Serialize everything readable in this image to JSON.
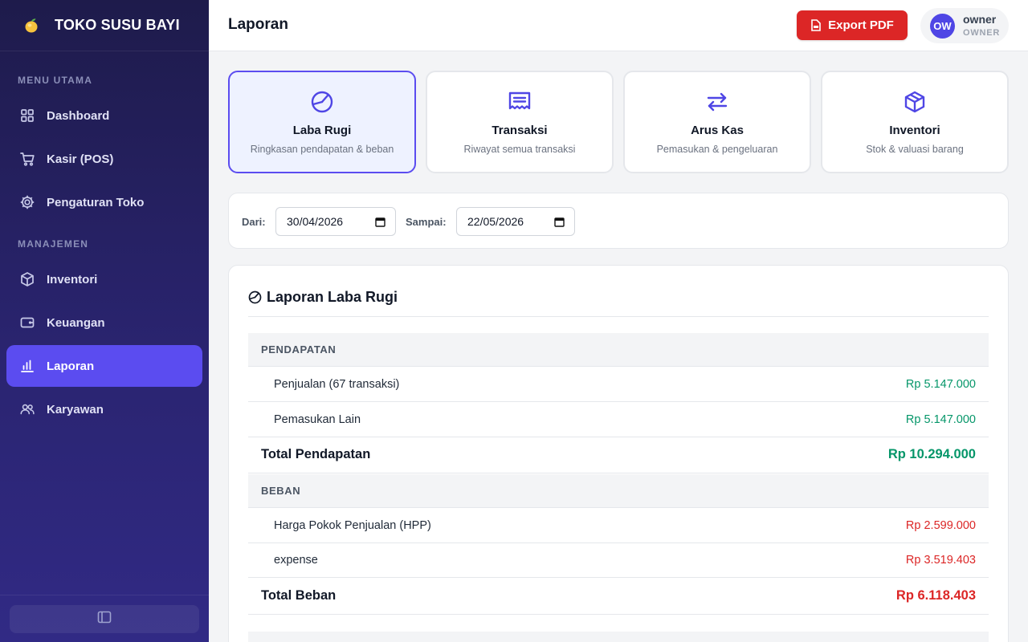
{
  "brand": {
    "name": "TOKO SUSU BAYI",
    "logo_icon": "lemon-icon"
  },
  "sidebar": {
    "section_main": "MENU UTAMA",
    "section_manage": "MANAJEMEN",
    "items": [
      {
        "label": "Dashboard",
        "icon": "grid-icon"
      },
      {
        "label": "Kasir (POS)",
        "icon": "cart-icon"
      },
      {
        "label": "Pengaturan Toko",
        "icon": "gear-icon"
      },
      {
        "label": "Inventori",
        "icon": "box-icon"
      },
      {
        "label": "Keuangan",
        "icon": "wallet-icon"
      },
      {
        "label": "Laporan",
        "icon": "bar-chart-icon",
        "active": true
      },
      {
        "label": "Karyawan",
        "icon": "users-icon"
      }
    ],
    "collapse_icon": "sidebar-toggle-icon"
  },
  "header": {
    "title": "Laporan",
    "export_label": "Export PDF",
    "user": {
      "initials": "OW",
      "name": "owner",
      "role": "OWNER"
    }
  },
  "report_types": [
    {
      "title": "Laba Rugi",
      "desc": "Ringkasan pendapatan & beban",
      "icon": "pie-chart-icon",
      "active": true
    },
    {
      "title": "Transaksi",
      "desc": "Riwayat semua transaksi",
      "icon": "receipt-icon"
    },
    {
      "title": "Arus Kas",
      "desc": "Pemasukan & pengeluaran",
      "icon": "arrows-exchange-icon"
    },
    {
      "title": "Inventori",
      "desc": "Stok & valuasi barang",
      "icon": "package-icon"
    }
  ],
  "filter": {
    "from_label": "Dari:",
    "from_value": "30/04/2026",
    "to_label": "Sampai:",
    "to_value": "22/05/2026"
  },
  "report": {
    "title": "Laporan Laba Rugi",
    "income": {
      "section": "PENDAPATAN",
      "rows": [
        {
          "label": "Penjualan (67 transaksi)",
          "value": "Rp 5.147.000"
        },
        {
          "label": "Pemasukan Lain",
          "value": "Rp 5.147.000"
        }
      ],
      "total_label": "Total Pendapatan",
      "total_value": "Rp 10.294.000"
    },
    "expense": {
      "section": "BEBAN",
      "rows": [
        {
          "label": "Harga Pokok Penjualan (HPP)",
          "value": "Rp 2.599.000"
        },
        {
          "label": "expense",
          "value": "Rp 3.519.403"
        }
      ],
      "total_label": "Total Beban",
      "total_value": "Rp 6.118.403"
    }
  },
  "colors": {
    "accent": "#5b4cf0",
    "sidebar": "#1e1b4b",
    "danger": "#dc2626",
    "success": "#059669"
  }
}
